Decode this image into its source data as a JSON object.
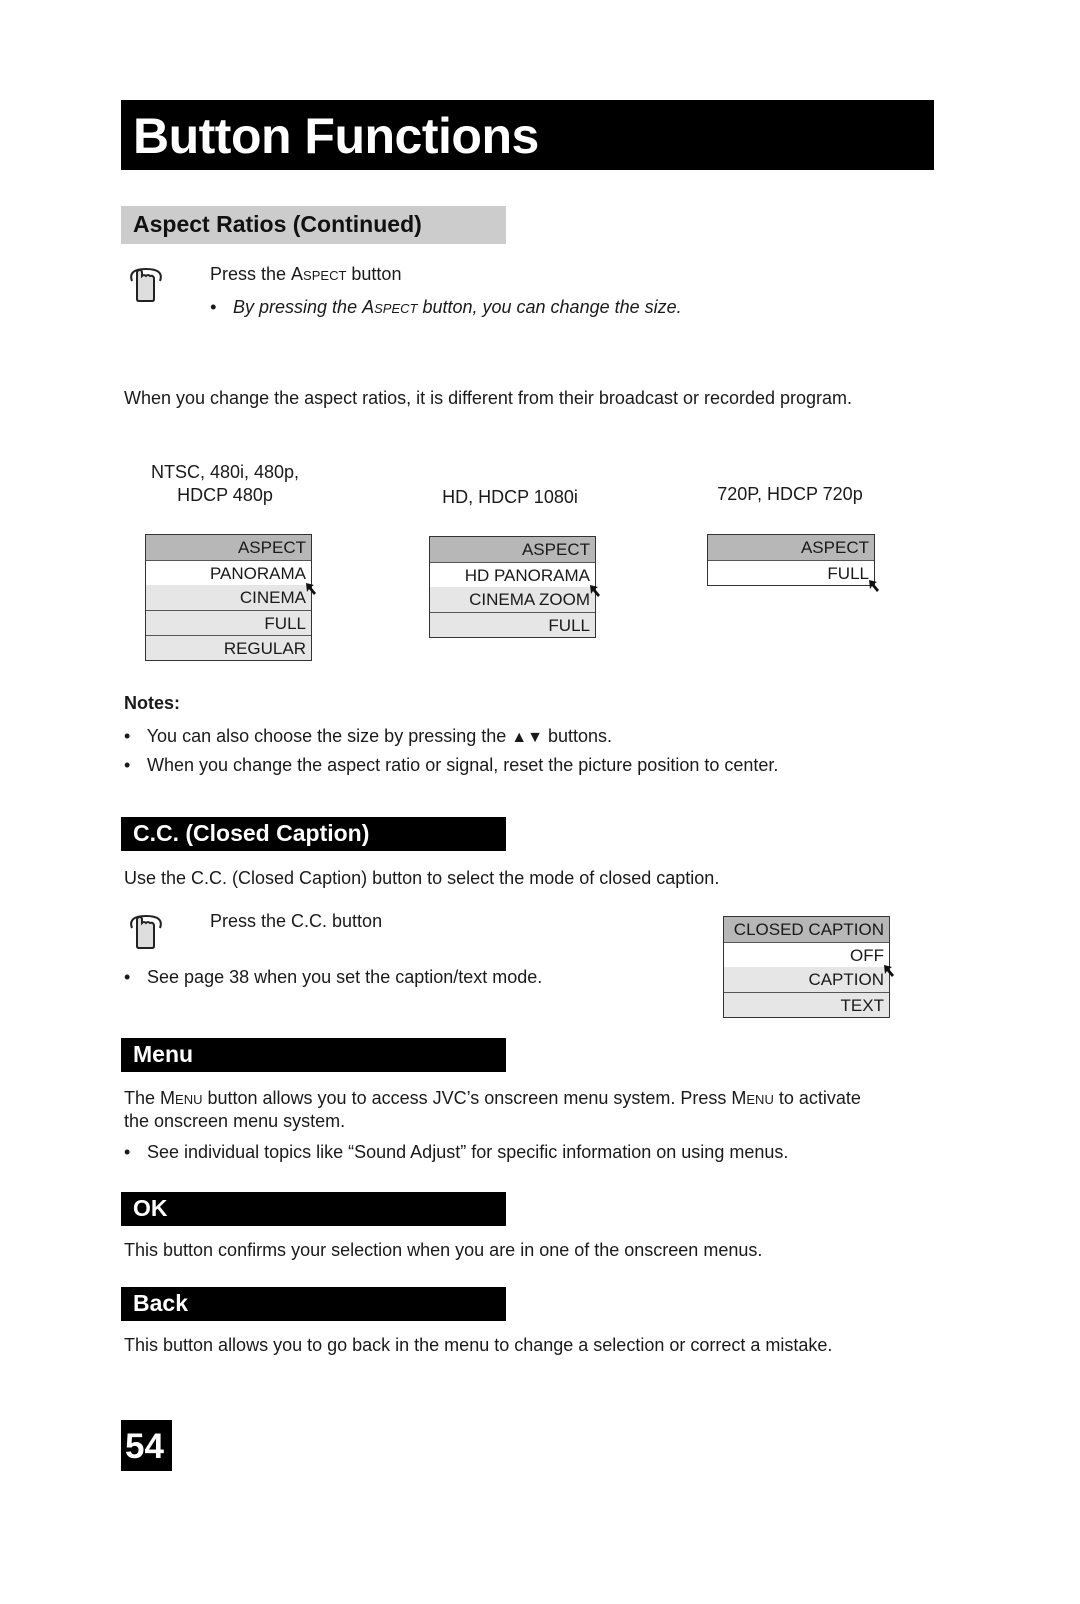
{
  "header": {
    "title": "Button Functions"
  },
  "aspect_section": {
    "heading": "Aspect Ratios (Continued)",
    "instruction": {
      "pre": "Press the ",
      "key": "Aspect",
      "post": " button"
    },
    "bullet": {
      "pre": "By pressing the ",
      "key": "Aspect",
      "post": " button, you can change the size."
    },
    "intro": "When you change the aspect ratios, it is different from their broadcast or recorded program.",
    "menus": [
      {
        "source_line1": "NTSC, 480i, 480p,",
        "source_line2": "HDCP 480p",
        "header": "ASPECT",
        "items": [
          "PANORAMA",
          "CINEMA",
          "FULL",
          "REGULAR"
        ],
        "selected": "PANORAMA"
      },
      {
        "source_line1": "HD, HDCP 1080i",
        "header": "ASPECT",
        "items": [
          "HD PANORAMA",
          "CINEMA ZOOM",
          "FULL"
        ],
        "selected": "HD PANORAMA"
      },
      {
        "source_line1": "720P, HDCP 720p",
        "header": "ASPECT",
        "items": [
          "FULL"
        ],
        "selected": "FULL"
      }
    ],
    "notes_label": "Notes:",
    "notes": [
      {
        "pre": "You can also choose the size by pressing the ",
        "arrows": "▲▼",
        "post": "  buttons."
      },
      {
        "pre": "When you change the aspect ratio or signal, reset the picture position to center."
      }
    ]
  },
  "cc_section": {
    "heading": "C.C. (Closed Caption)",
    "intro": "Use the C.C. (Closed Caption) button to select the mode of closed caption.",
    "instruction": "Press the C.C. button",
    "bullet": "See page 38 when you set the caption/text mode.",
    "menu": {
      "header": "CLOSED CAPTION",
      "items": [
        "OFF",
        "CAPTION",
        "TEXT"
      ],
      "selected": "OFF"
    }
  },
  "menu_section": {
    "heading": "Menu",
    "intro": {
      "p1": "The ",
      "k1": "Menu",
      "p2": " button allows you to access JVC’s onscreen menu system. Press ",
      "k2": "Menu",
      "p3": " to activate",
      "line2": "the onscreen menu system."
    },
    "bullet": "See individual topics like “Sound Adjust” for specific information on using menus."
  },
  "ok_section": {
    "heading": "OK",
    "text": "This button confirms your selection when you are in one of the onscreen menus."
  },
  "back_section": {
    "heading": "Back",
    "text": "This button allows you to go back in the menu to change a selection or correct a mistake."
  },
  "footer": {
    "page_number": "54"
  }
}
